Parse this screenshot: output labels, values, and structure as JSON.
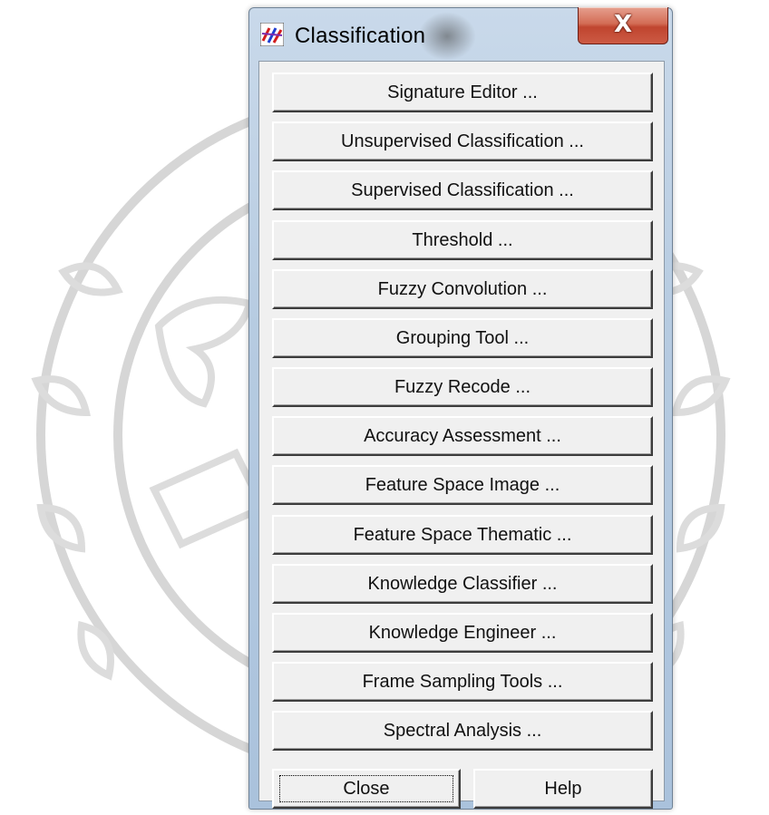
{
  "window": {
    "title": "Classification",
    "close_glyph": "X",
    "icon": "classification-app-icon"
  },
  "menu": {
    "items": [
      "Signature Editor ...",
      "Unsupervised Classification ...",
      "Supervised Classification ...",
      "Threshold ...",
      "Fuzzy Convolution ...",
      "Grouping Tool ...",
      "Fuzzy Recode ...",
      "Accuracy Assessment ...",
      "Feature Space Image ...",
      "Feature Space Thematic ...",
      "Knowledge Classifier ...",
      "Knowledge Engineer ...",
      "Frame Sampling Tools ...",
      "Spectral Analysis ..."
    ]
  },
  "footer": {
    "close_label": "Close",
    "help_label": "Help"
  },
  "colors": {
    "dialog_face": "#f0f0f0",
    "title_frame": "#b6cbe1",
    "close_button": "#c0452f",
    "watermark": "#d6d6d6"
  }
}
